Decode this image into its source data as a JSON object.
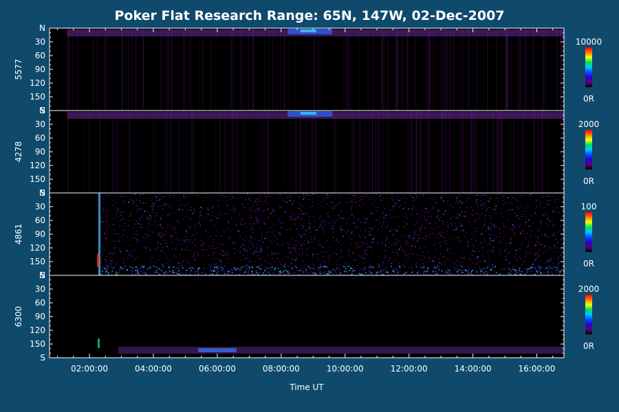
{
  "chart_data": {
    "type": "heatmap",
    "title": "Poker Flat Research Range: 65N, 147W, 02-Dec-2007",
    "xlabel": "Time UT",
    "x_ticks": [
      "02:00:00",
      "04:00:00",
      "06:00:00",
      "08:00:00",
      "10:00:00",
      "12:00:00",
      "14:00:00",
      "16:00:00"
    ],
    "x_tick_hours": [
      2,
      4,
      6,
      8,
      10,
      12,
      14,
      16
    ],
    "x_range_hours": [
      0.75,
      16.85
    ],
    "y_ticks": [
      "N",
      "30",
      "60",
      "90",
      "120",
      "150",
      "S"
    ],
    "y_tick_values": [
      0,
      30,
      60,
      90,
      120,
      150,
      180
    ],
    "y_range": [
      0,
      180
    ],
    "colormap": [
      "#000000",
      "#5a0078",
      "#2a00d0",
      "#0050ff",
      "#00c8ff",
      "#00e060",
      "#ffff00",
      "#ff7800",
      "#ff0000"
    ],
    "panels": [
      {
        "label": "5577",
        "scale_max": "10000",
        "scale_min": "0R"
      },
      {
        "label": "4278",
        "scale_max": "2000",
        "scale_min": "0R"
      },
      {
        "label": "4861",
        "scale_max": "100",
        "scale_min": "0R"
      },
      {
        "label": "6300",
        "scale_max": "2000",
        "scale_min": "0R"
      }
    ]
  }
}
